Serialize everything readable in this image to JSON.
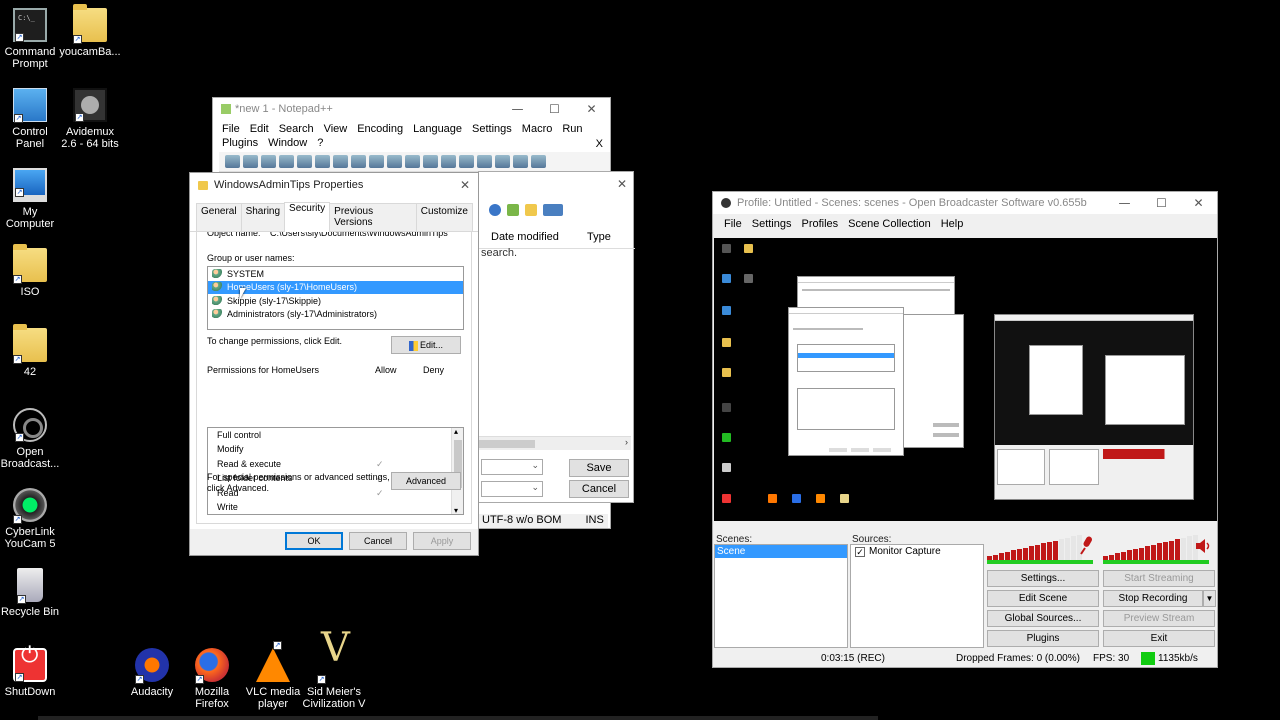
{
  "desktop": {
    "left_icons": [
      {
        "label": "Command Prompt",
        "icon": "command-prompt-icon"
      },
      {
        "label": "Control Panel",
        "icon": "control-panel-icon"
      },
      {
        "label": "My Computer",
        "icon": "computer-icon"
      },
      {
        "label": "ISO",
        "icon": "folder-icon"
      },
      {
        "label": "42",
        "icon": "folder-icon"
      },
      {
        "label": "Open Broadcast...",
        "icon": "obs-icon"
      },
      {
        "label": "CyberLink YouCam 5",
        "icon": "webcam-icon"
      },
      {
        "label": "Recycle Bin",
        "icon": "recycle-bin-icon"
      },
      {
        "label": "ShutDown",
        "icon": "power-icon"
      }
    ],
    "second_col_icons": [
      {
        "label": "youcamBa...",
        "icon": "file-icon"
      },
      {
        "label": "Avidemux 2.6 - 64 bits",
        "icon": "film-icon"
      }
    ],
    "bottom_icons": [
      {
        "label": "Audacity",
        "icon": "audacity-icon"
      },
      {
        "label": "Mozilla Firefox",
        "icon": "firefox-icon"
      },
      {
        "label": "VLC media player",
        "icon": "vlc-icon"
      },
      {
        "label": "Sid Meier's Civilization V",
        "icon": "civilization-icon"
      }
    ]
  },
  "notepad": {
    "title": "*new 1 - Notepad++",
    "menu": [
      "File",
      "Edit",
      "Search",
      "View",
      "Encoding",
      "Language",
      "Settings",
      "Macro",
      "Run",
      "Plugins",
      "Window",
      "?"
    ],
    "menu_close": "X",
    "encoding": "UTF-8 w/o BOM",
    "mode": "INS"
  },
  "save_dialog": {
    "col_date": "Date modified",
    "col_type": "Type",
    "empty_text": "search.",
    "save_label": "Save",
    "cancel_label": "Cancel"
  },
  "properties": {
    "title": "WindowsAdminTips Properties",
    "tabs": [
      "General",
      "Sharing",
      "Security",
      "Previous Versions",
      "Customize"
    ],
    "active_tab": "Security",
    "object_label": "Object name:",
    "object_value": "C:\\Users\\sly\\Documents\\WindowsAdminTips",
    "group_label": "Group or user names:",
    "groups": [
      {
        "name": "SYSTEM",
        "selected": false
      },
      {
        "name": "HomeUsers (sly-17\\HomeUsers)",
        "selected": true
      },
      {
        "name": "Skippie (sly-17\\Skippie)",
        "selected": false
      },
      {
        "name": "Administrators (sly-17\\Administrators)",
        "selected": false
      }
    ],
    "change_text": "To change permissions, click Edit.",
    "edit_label": "Edit...",
    "perm_label": "Permissions for HomeUsers",
    "allow_label": "Allow",
    "deny_label": "Deny",
    "permissions": [
      {
        "name": "Full control",
        "allow": ""
      },
      {
        "name": "Modify",
        "allow": ""
      },
      {
        "name": "Read & execute",
        "allow": "✓"
      },
      {
        "name": "List folder contents",
        "allow": "✓"
      },
      {
        "name": "Read",
        "allow": "✓"
      },
      {
        "name": "Write",
        "allow": ""
      }
    ],
    "special_text_1": "For special permissions or advanced settings,",
    "special_text_2": "click Advanced.",
    "advanced_label": "Advanced",
    "ok_label": "OK",
    "cancel_label": "Cancel",
    "apply_label": "Apply"
  },
  "obs": {
    "title": "Profile: Untitled - Scenes: scenes - Open Broadcaster Software v0.655b",
    "menu": [
      "File",
      "Settings",
      "Profiles",
      "Scene Collection",
      "Help"
    ],
    "scenes_label": "Scenes:",
    "sources_label": "Sources:",
    "scenes": [
      "Scene"
    ],
    "sources": [
      {
        "name": "Monitor Capture",
        "checked": true
      }
    ],
    "mic_level": 0.8,
    "desktop_level": 0.85,
    "buttons": {
      "settings": "Settings...",
      "start_streaming": "Start Streaming",
      "edit_scene": "Edit Scene",
      "stop_recording": "Stop Recording",
      "global_sources": "Global Sources...",
      "preview_stream": "Preview Stream",
      "plugins": "Plugins",
      "exit": "Exit"
    },
    "status": {
      "time": "0:03:15 (REC)",
      "dropped": "Dropped Frames: 0 (0.00%)",
      "fps": "FPS: 30",
      "bitrate": "1135kb/s",
      "bitrate_color": "#11cc11"
    }
  }
}
